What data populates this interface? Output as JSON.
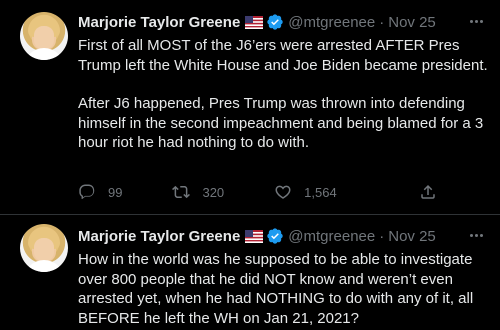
{
  "tweets": [
    {
      "author": {
        "name": "Marjorie Taylor Greene",
        "handle": "@mtgreenee",
        "verified": true,
        "flag": "us-flag"
      },
      "separator": "·",
      "date": "Nov 25",
      "paragraphs": [
        "First of all MOST of the J6’ers were arrested AFTER Pres Trump left the White House and Joe Biden became president.",
        "After J6 happened, Pres Trump was thrown into defending himself in the second impeachment and being blamed for a 3 hour riot  he had nothing to do with."
      ],
      "actions": {
        "replies": "99",
        "retweets": "320",
        "likes": "1,564"
      }
    },
    {
      "author": {
        "name": "Marjorie Taylor Greene",
        "handle": "@mtgreenee",
        "verified": true,
        "flag": "us-flag"
      },
      "separator": "·",
      "date": "Nov 25",
      "paragraphs": [
        "How in the world was he supposed to be able to investigate over 800 people that he did NOT know and weren’t even arrested yet, when he had NOTHING to do with any of it, all BEFORE he left the WH on Jan 21, 2021?"
      ]
    }
  ],
  "icons": {
    "reply": "reply-icon",
    "retweet": "retweet-icon",
    "like": "heart-icon",
    "share": "share-icon",
    "more": "more-icon",
    "verified": "verified-badge-icon"
  },
  "colors": {
    "background": "#000000",
    "text": "#e7e9ea",
    "muted": "#71767b",
    "verified": "#1d9bf0",
    "divider": "#2f3336"
  }
}
